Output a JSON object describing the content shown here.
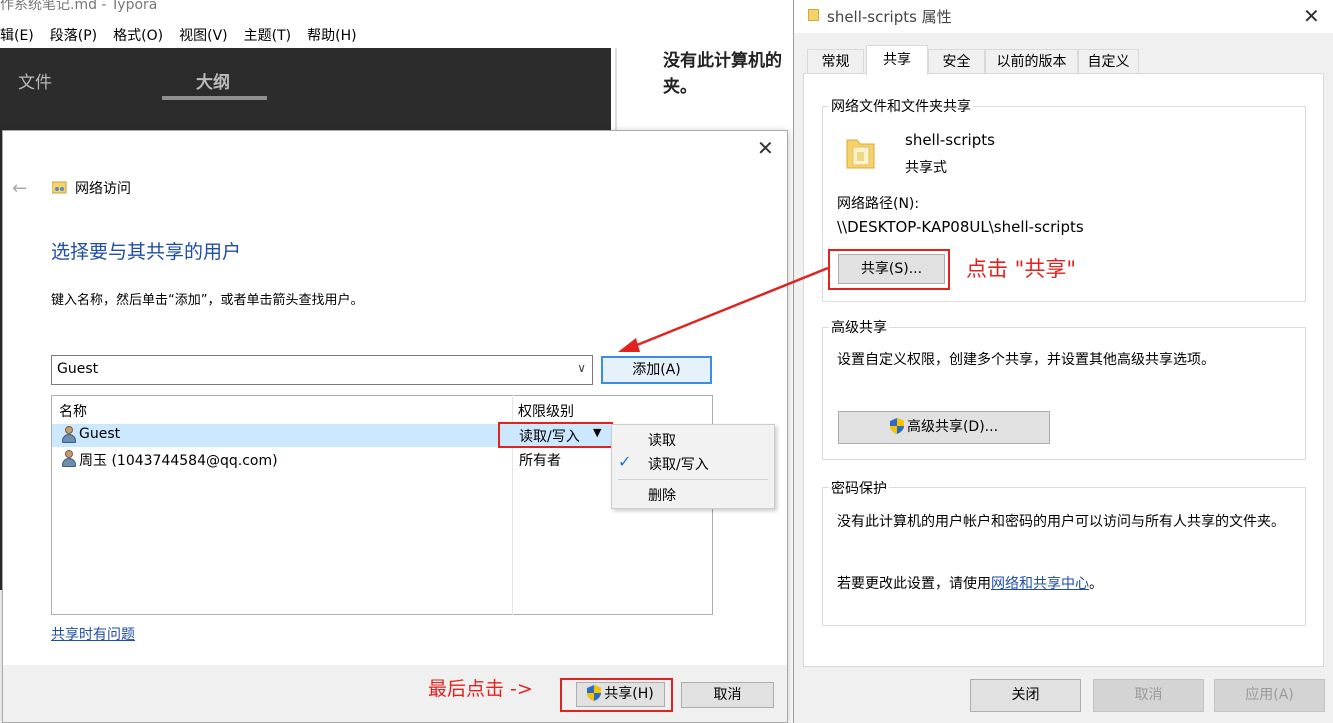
{
  "typora": {
    "title": "作系统笔记.md - Typora",
    "menu": [
      "辑(E)",
      "段落(P)",
      "格式(O)",
      "视图(V)",
      "主题(T)",
      "帮助(H)"
    ],
    "sidebar_tabs": {
      "files": "文件",
      "outline": "大纲"
    },
    "content_snippet": "没有此计算机的 夹。"
  },
  "share_dialog": {
    "crumb": "网络访问",
    "heading": "选择要与其共享的用户",
    "instruction": "键入名称，然后单击“添加”，或者单击箭头查找用户。",
    "combo_value": "Guest",
    "add_button": "添加(A)",
    "columns": {
      "name": "名称",
      "level": "权限级别"
    },
    "rows": [
      {
        "name": "Guest",
        "level": "读取/写入"
      },
      {
        "name": "周玉 (1043744584@qq.com)",
        "level": "所有者"
      }
    ],
    "perm_menu": {
      "read": "读取",
      "read_write": "读取/写入",
      "remove": "删除"
    },
    "trouble_link": "共享时有问题",
    "final_note": "最后点击 ->",
    "share_button": "共享(H)",
    "cancel_button": "取消"
  },
  "props": {
    "title": "shell-scripts 属性",
    "tabs": [
      "常规",
      "共享",
      "安全",
      "以前的版本",
      "自定义"
    ],
    "group1": {
      "title": "网络文件和文件夹共享",
      "folder_name": "shell-scripts",
      "folder_state": "共享式",
      "path_label": "网络路径(N):",
      "path_value": "\\\\DESKTOP-KAP08UL\\shell-scripts",
      "share_button": "共享(S)...",
      "note": "点击 \"共享\""
    },
    "group2": {
      "title": "高级共享",
      "desc": "设置自定义权限，创建多个共享，并设置其他高级共享选项。",
      "button": "高级共享(D)..."
    },
    "group3": {
      "title": "密码保护",
      "desc": "没有此计算机的用户帐户和密码的用户可以访问与所有人共享的文件夹。",
      "change_prefix": "若要更改此设置，请使用",
      "link": "网络和共享中心",
      "change_suffix": "。"
    },
    "buttons": {
      "close": "关闭",
      "cancel": "取消",
      "apply": "应用(A)"
    }
  },
  "colors": {
    "annotation_red": "#e1231f",
    "link_blue": "#1f4ea8",
    "accent_blue": "#3c8de0"
  }
}
